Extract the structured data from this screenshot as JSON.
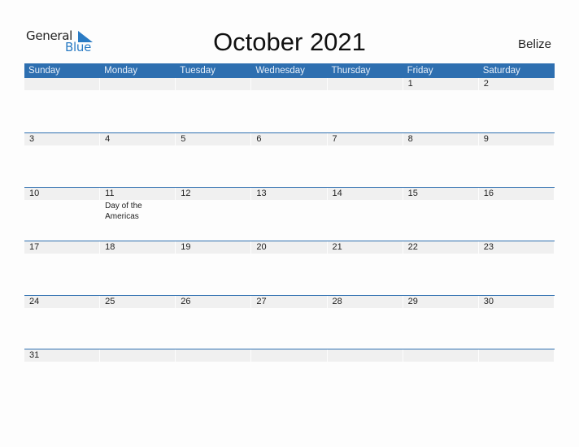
{
  "logo": {
    "line1": "General",
    "line2": "Blue",
    "accent": "#2a7bc4"
  },
  "title": "October 2021",
  "country": "Belize",
  "colors": {
    "header_bg": "#2e6fb0",
    "day_band": "#f0f0f0"
  },
  "weekdays": [
    "Sunday",
    "Monday",
    "Tuesday",
    "Wednesday",
    "Thursday",
    "Friday",
    "Saturday"
  ],
  "weeks": [
    [
      {
        "day": ""
      },
      {
        "day": ""
      },
      {
        "day": ""
      },
      {
        "day": ""
      },
      {
        "day": ""
      },
      {
        "day": "1"
      },
      {
        "day": "2"
      }
    ],
    [
      {
        "day": "3"
      },
      {
        "day": "4"
      },
      {
        "day": "5"
      },
      {
        "day": "6"
      },
      {
        "day": "7"
      },
      {
        "day": "8"
      },
      {
        "day": "9"
      }
    ],
    [
      {
        "day": "10"
      },
      {
        "day": "11",
        "holiday": "Day of the Americas"
      },
      {
        "day": "12"
      },
      {
        "day": "13"
      },
      {
        "day": "14"
      },
      {
        "day": "15"
      },
      {
        "day": "16"
      }
    ],
    [
      {
        "day": "17"
      },
      {
        "day": "18"
      },
      {
        "day": "19"
      },
      {
        "day": "20"
      },
      {
        "day": "21"
      },
      {
        "day": "22"
      },
      {
        "day": "23"
      }
    ],
    [
      {
        "day": "24"
      },
      {
        "day": "25"
      },
      {
        "day": "26"
      },
      {
        "day": "27"
      },
      {
        "day": "28"
      },
      {
        "day": "29"
      },
      {
        "day": "30"
      }
    ],
    [
      {
        "day": "31"
      },
      {
        "day": ""
      },
      {
        "day": ""
      },
      {
        "day": ""
      },
      {
        "day": ""
      },
      {
        "day": ""
      },
      {
        "day": ""
      }
    ]
  ]
}
